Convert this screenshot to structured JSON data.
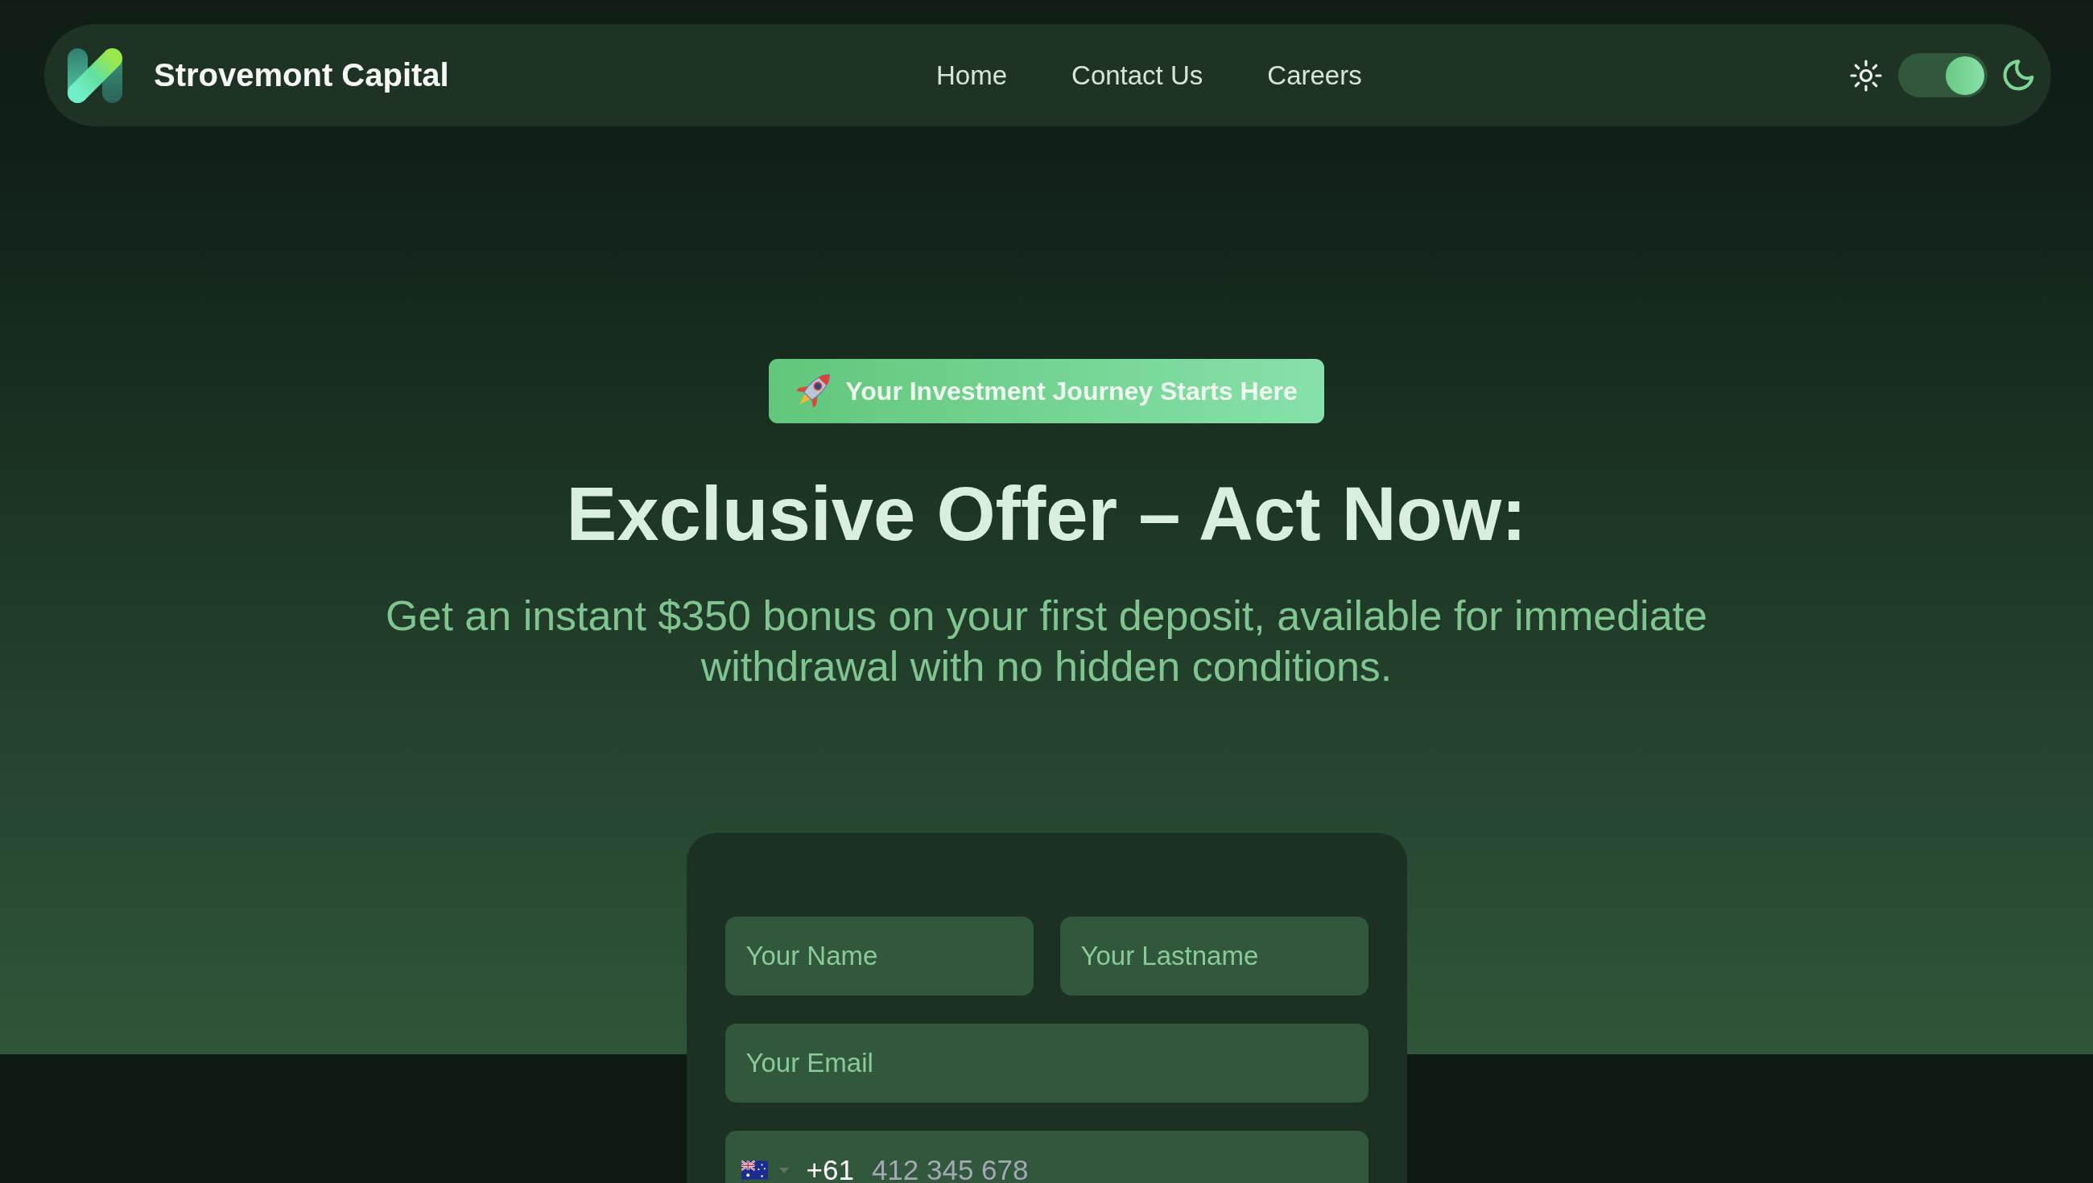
{
  "header": {
    "brand": "Strovemont Capital",
    "nav": [
      {
        "label": "Home"
      },
      {
        "label": "Contact Us"
      },
      {
        "label": "Careers"
      }
    ],
    "theme_toggle": {
      "on": true
    }
  },
  "hero": {
    "badge": "Your Investment Journey Starts Here",
    "title": "Exclusive Offer – Act Now:",
    "subtitle": "Get an instant $350 bonus on your first deposit, available for immediate withdrawal with no hidden conditions."
  },
  "form": {
    "first_name": {
      "placeholder": "Your Name"
    },
    "last_name": {
      "placeholder": "Your Lastname"
    },
    "email": {
      "placeholder": "Your Email"
    },
    "phone": {
      "dial_code": "+61",
      "placeholder": "412 345 678"
    }
  }
}
